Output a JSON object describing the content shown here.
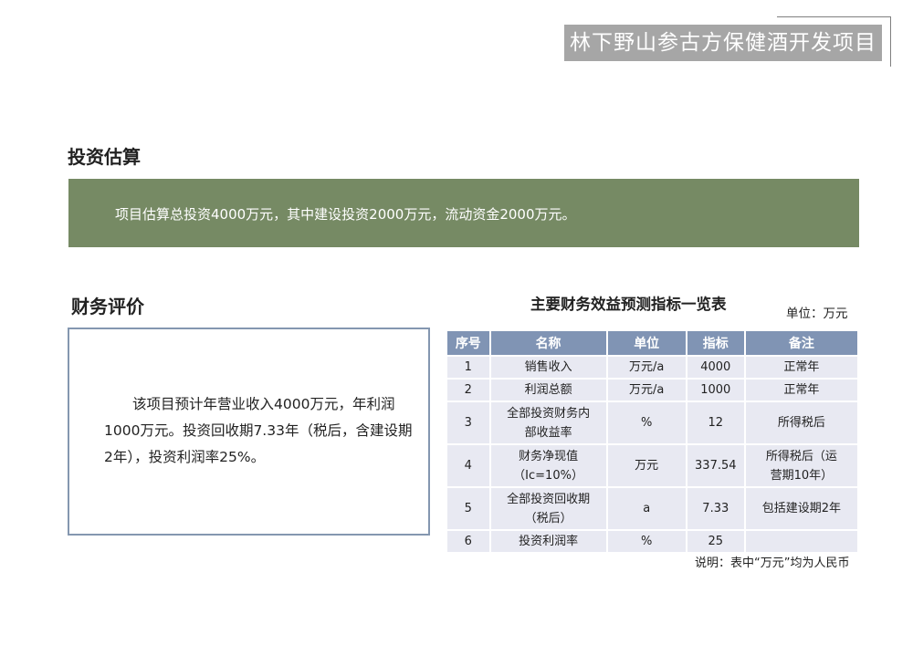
{
  "header": {
    "title": "林下野山参古方保健酒开发项目"
  },
  "investment": {
    "heading": "投资估算",
    "summary": "项目估算总投资4000万元，其中建设投资2000万元，流动资金2000万元。"
  },
  "finance": {
    "heading": "财务评价",
    "text": "该项目预计年营业收入4000万元，年利润1000万元。投资回收期7.33年（税后，含建设期2年），投资利润率25%。"
  },
  "table": {
    "title": "主要财务效益预测指标一览表",
    "unit": "单位：万元",
    "columns": [
      "序号",
      "名称",
      "单位",
      "指标",
      "备注"
    ],
    "rows": [
      {
        "no": "1",
        "name": "销售收入",
        "unit": "万元/a",
        "value": "4000",
        "remark": "正常年"
      },
      {
        "no": "2",
        "name": "利润总额",
        "unit": "万元/a",
        "value": "1000",
        "remark": "正常年"
      },
      {
        "no": "3",
        "name": "全部投资财务内部收益率",
        "unit": "%",
        "value": "12",
        "remark": "所得税后"
      },
      {
        "no": "4",
        "name": "财务净现值（Ic=10%）",
        "unit": "万元",
        "value": "337.54",
        "remark": "所得税后（运营期10年）"
      },
      {
        "no": "5",
        "name": "全部投资回收期（税后）",
        "unit": "a",
        "value": "7.33",
        "remark": "包括建设期2年"
      },
      {
        "no": "6",
        "name": "投资利润率",
        "unit": "%",
        "value": "25",
        "remark": ""
      }
    ],
    "note": "说明：表中“万元”均为人民币"
  }
}
